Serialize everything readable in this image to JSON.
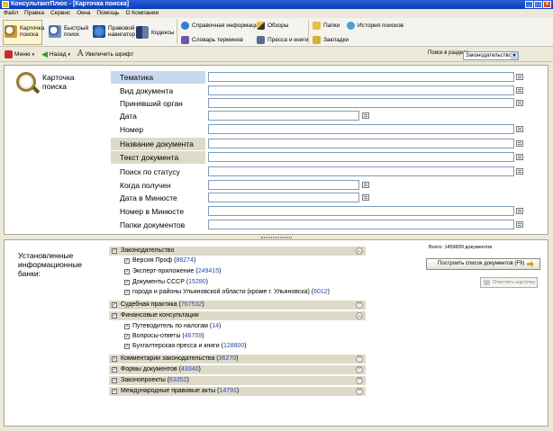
{
  "window": {
    "title": "КонсультантПлюс - [Карточка поиска]"
  },
  "menu": [
    "Файл",
    "Правка",
    "Сервис",
    "Окна",
    "Помощь",
    "О Компании"
  ],
  "ribbon": {
    "card_search": "Карточка поиска",
    "quick_search": "Быстрый поиск",
    "legal_navigator": "Правовой навигатор",
    "codes": "Кодексы",
    "reference_info": "Справочная информация",
    "dictionary": "Словарь терминов",
    "reviews": "Обзоры",
    "press_books": "Пресса и книги",
    "folders": "Папки",
    "bookmarks": "Закладки",
    "search_history": "История поисков"
  },
  "toolbar": {
    "menu_label": "Меню",
    "back_label": "Назад",
    "font_label": "Увеличить шрифт",
    "section_label": "Поиск в разделе",
    "section_value": "Законодательство"
  },
  "card": {
    "title": "Карточка поиска",
    "fields": [
      "Тематика",
      "Вид документа",
      "Принявший орган",
      "Дата",
      "Номер",
      "Название документа",
      "Текст документа",
      "Поиск по статусу",
      "Когда получен",
      "Дата в Минюсте",
      "Номер в Минюсте",
      "Папки документов"
    ]
  },
  "banks": {
    "title": "Установленные информационные банки:",
    "total": "Всего: 1459839 документов",
    "build_button": "Построить список документов (F9)",
    "clear_button": "Очистить карточку",
    "groups": [
      {
        "label": "Законодательство",
        "count": "",
        "items": [
          {
            "label": "Версия Проф",
            "count": "88274"
          },
          {
            "label": "Эксперт-приложение",
            "count": "249415"
          },
          {
            "label": "Документы СССР",
            "count": "15280"
          },
          {
            "label": "города и районы Ульяновской области (кроме г. Ульяновска)",
            "count": "6012"
          }
        ]
      },
      {
        "label": "Судебная практика",
        "count": "767532",
        "items": []
      },
      {
        "label": "Финансовые консультации",
        "count": "",
        "items": [
          {
            "label": "Путеводитель по налогам",
            "count": "14"
          },
          {
            "label": "Вопросы-ответы",
            "count": "46759"
          },
          {
            "label": "Бухгалтерская пресса и книги",
            "count": "128800"
          }
        ]
      },
      {
        "label": "Комментарии законодательства",
        "count": "36270",
        "items": []
      },
      {
        "label": "Формы документов",
        "count": "43340",
        "items": []
      },
      {
        "label": "Законопроекты",
        "count": "63352",
        "items": []
      },
      {
        "label": "Международные правовые акты",
        "count": "14791",
        "items": []
      }
    ]
  },
  "colors": {
    "accent": "#2050b0",
    "title_bar": "#0a3cb8",
    "group_bg": "#dddac8"
  }
}
